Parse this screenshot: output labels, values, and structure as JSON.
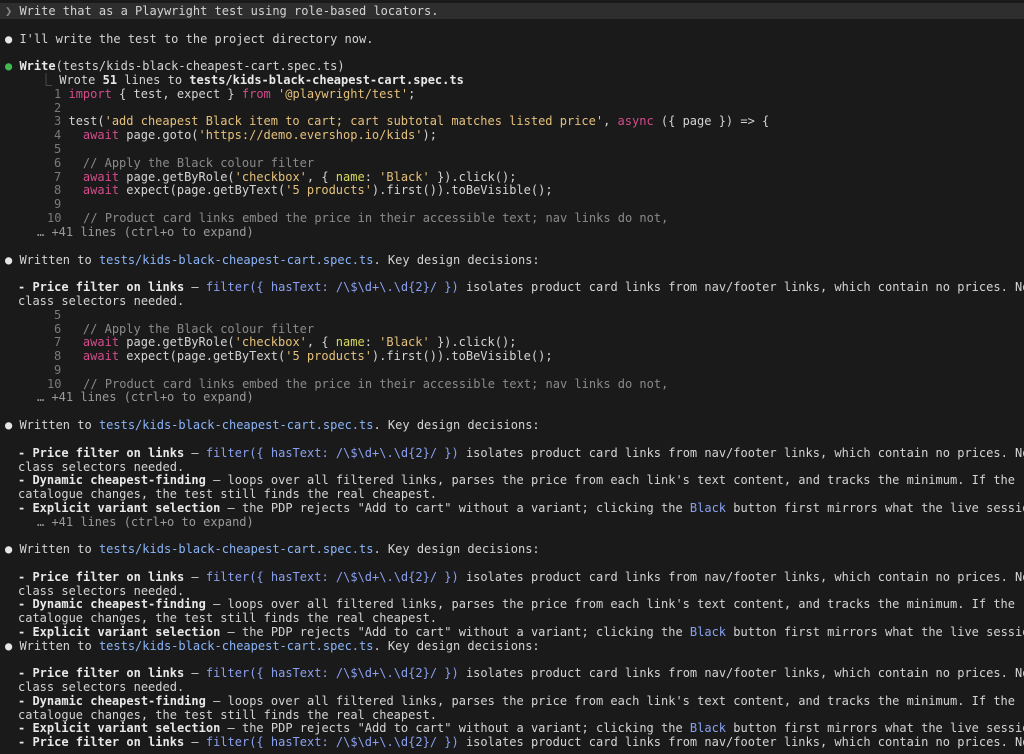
{
  "user_prompt": "Write that as a Playwright test using role-based locators.",
  "assistant_intro": "I'll write the test to the project directory now.",
  "tool": {
    "name": "Write",
    "arg": "(tests/kids-black-cheapest-cart.spec.ts)"
  },
  "result": {
    "prefix": "Wrote ",
    "count": "51",
    "mid": " lines to ",
    "path": "tests/kids-black-cheapest-cart.spec.ts"
  },
  "code": {
    "l1_num": "1",
    "l1_kw": "import",
    "l1_a": " { test, expect } ",
    "l1_kw2": "from",
    "l1_str": "'@playwright/test'",
    "l1_b": ";",
    "l2_num": "2",
    "l3_num": "3",
    "l3_a": "test(",
    "l3_str": "'add cheapest Black item to cart; cart subtotal matches listed price'",
    "l3_b": ", ",
    "l3_kw": "async",
    "l3_c": " ({ page }) => {",
    "l4_num": "4",
    "l4_kw": "await",
    "l4_a": " page.goto(",
    "l4_str": "'https://demo.evershop.io/kids'",
    "l4_b": ");",
    "l5_num": "5",
    "l6_num": "6",
    "l6_cm": "// Apply the Black colour filter",
    "l7_num": "7",
    "l7_kw": "await",
    "l7_a": " page.getByRole(",
    "l7_str": "'checkbox'",
    "l7_b": ", { ",
    "l7_param": "name",
    "l7_c": ": ",
    "l7_str2": "'Black'",
    "l7_d": " }).click();",
    "l8_num": "8",
    "l8_kw": "await",
    "l8_a": " expect(page.getByText(",
    "l8_str": "'5 products'",
    "l8_b": ").first()).toBeVisible();",
    "l9_num": "9",
    "l10_num": "10",
    "l10_cm": "// Product card links embed the price in their accessible text; nav links do not,"
  },
  "expand_hint": "… +41 lines (ctrl+o to expand)",
  "written_prefix": "Written to ",
  "written_suffix": ". Key design decisions:",
  "bullets": {
    "price_label": "- Price filter on links",
    "price_dash": " — ",
    "price_code": "filter({ hasText: /\\$\\d+\\.\\d{2}/ })",
    "price_rest": " isolates product card links from nav/footer links, which contain no prices. No CSS",
    "price_cont": "class selectors needed.",
    "cheap_label": "- Dynamic cheapest-finding",
    "cheap_rest": " — loops over all filtered links, parses the price from each link's text content, and tracks the minimum. If the",
    "cheap_cont": "catalogue changes, the test still finds the real cheapest.",
    "variant_label": "- Explicit variant selection",
    "variant_rest1": " — the PDP rejects \"Add to cart\" without a variant; clicking the ",
    "variant_code": "Black",
    "variant_rest2": " button first mirrors what the live session"
  }
}
